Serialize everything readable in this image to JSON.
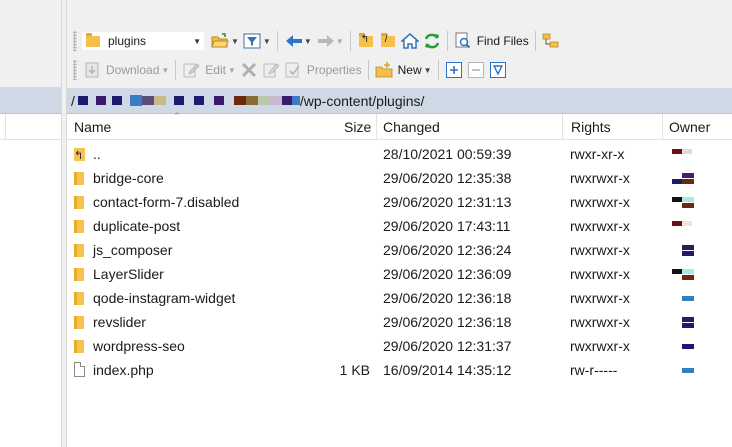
{
  "toolbar": {
    "drive_label": "plugins",
    "find_files_label": "Find Files",
    "download_label": "Download",
    "edit_label": "Edit",
    "properties_label": "Properties",
    "new_label": "New"
  },
  "path": {
    "prefix": "/",
    "visible_suffix": "/wp-content/plugins/"
  },
  "columns": {
    "name": "Name",
    "size": "Size",
    "changed": "Changed",
    "rights": "Rights",
    "owner": "Owner"
  },
  "files": [
    {
      "name": "..",
      "type": "parent",
      "size": "",
      "changed": "28/10/2021 00:59:39",
      "rights": "rwxr-xr-x"
    },
    {
      "name": "bridge-core",
      "type": "folder",
      "size": "",
      "changed": "29/06/2020 12:35:38",
      "rights": "rwxrwxr-x"
    },
    {
      "name": "contact-form-7.disabled",
      "type": "folder",
      "size": "",
      "changed": "29/06/2020 12:31:13",
      "rights": "rwxrwxr-x"
    },
    {
      "name": "duplicate-post",
      "type": "folder",
      "size": "",
      "changed": "29/06/2020 17:43:11",
      "rights": "rwxrwxr-x"
    },
    {
      "name": "js_composer",
      "type": "folder",
      "size": "",
      "changed": "29/06/2020 12:36:24",
      "rights": "rwxrwxr-x"
    },
    {
      "name": "LayerSlider",
      "type": "folder",
      "size": "",
      "changed": "29/06/2020 12:36:09",
      "rights": "rwxrwxr-x"
    },
    {
      "name": "qode-instagram-widget",
      "type": "folder",
      "size": "",
      "changed": "29/06/2020 12:36:18",
      "rights": "rwxrwxr-x"
    },
    {
      "name": "revslider",
      "type": "folder",
      "size": "",
      "changed": "29/06/2020 12:36:18",
      "rights": "rwxrwxr-x"
    },
    {
      "name": "wordpress-seo",
      "type": "folder",
      "size": "",
      "changed": "29/06/2020 12:31:37",
      "rights": "rwxrwxr-x"
    },
    {
      "name": "index.php",
      "type": "file",
      "size": "1 KB",
      "changed": "16/09/2014 14:35:12",
      "rights": "rw-r-----"
    }
  ],
  "colors": {
    "path_bar_bg": "#cfd9e6",
    "toolbar_bg": "#f0f0f0",
    "folder": "#f6c34f"
  }
}
